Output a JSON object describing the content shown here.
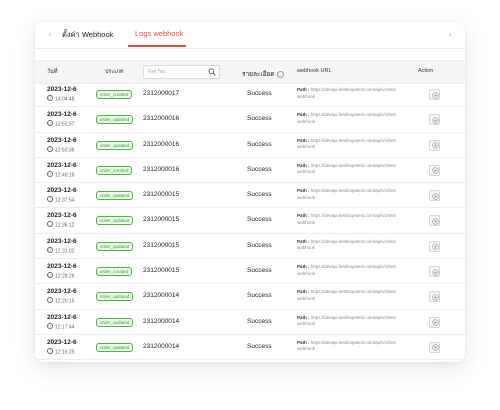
{
  "tabs": [
    {
      "label": "ตั้งค่า Webhook",
      "active": false
    },
    {
      "label": "Logs webhook",
      "active": true
    }
  ],
  "table": {
    "headers": {
      "date": "วันที่",
      "type": "ประเภท",
      "ref_placeholder": "Ref No.",
      "status": "รายละเอียด",
      "url": "webhook URL",
      "action": "Action"
    },
    "path_label": "Path :",
    "rows": [
      {
        "date": "2023-12-6",
        "time": "14:04:48",
        "type": "order_created",
        "ref": "2312000017",
        "status": "Success",
        "path": "https://devapi.ketshopstest.com/api/v1/test webhook"
      },
      {
        "date": "2023-12-6",
        "time": "12:52:57",
        "type": "order_updated",
        "ref": "2312000016",
        "status": "Success",
        "path": "https://devapi.ketshopstest.com/api/v1/test webhook"
      },
      {
        "date": "2023-12-6",
        "time": "12:50:36",
        "type": "order_updated",
        "ref": "2312000016",
        "status": "Success",
        "path": "https://devapi.ketshopstest.com/api/v1/test webhook"
      },
      {
        "date": "2023-12-6",
        "time": "12:49:16",
        "type": "order_created",
        "ref": "2312000016",
        "status": "Success",
        "path": "https://devapi.ketshopstest.com/api/v1/test webhook"
      },
      {
        "date": "2023-12-6",
        "time": "12:37:54",
        "type": "order_updated",
        "ref": "2312000015",
        "status": "Success",
        "path": "https://devapi.ketshopstest.com/api/v1/test webhook"
      },
      {
        "date": "2023-12-6",
        "time": "12:36:12",
        "type": "order_updated",
        "ref": "2312000015",
        "status": "Success",
        "path": "https://devapi.ketshopstest.com/api/v1/test webhook"
      },
      {
        "date": "2023-12-6",
        "time": "12:31:02",
        "type": "order_updated",
        "ref": "2312000015",
        "status": "Success",
        "path": "https://devapi.ketshopstest.com/api/v1/test webhook"
      },
      {
        "date": "2023-12-6",
        "time": "12:28:26",
        "type": "order_created",
        "ref": "2312000015",
        "status": "Success",
        "path": "https://devapi.ketshopstest.com/api/v1/test webhook"
      },
      {
        "date": "2023-12-6",
        "time": "12:20:15",
        "type": "order_updated",
        "ref": "2312000014",
        "status": "Success",
        "path": "https://devapi.ketshopstest.com/api/v1/test webhook"
      },
      {
        "date": "2023-12-6",
        "time": "12:17:44",
        "type": "order_updated",
        "ref": "2312000014",
        "status": "Success",
        "path": "https://devapi.ketshopstest.com/api/v1/test webhook"
      },
      {
        "date": "2023-12-6",
        "time": "12:16:25",
        "type": "order_updated",
        "ref": "2312000014",
        "status": "Success",
        "path": "https://devapi.ketshopstest.com/api/v1/test webhook"
      }
    ]
  },
  "colors": {
    "accent": "#e0503c",
    "badge_green": "#4bb543",
    "header_bg": "#f5f5f5"
  },
  "icons": {
    "tab_prev": "chevron-left-icon",
    "tab_next": "chevron-right-icon",
    "search": "search-icon",
    "info": "info-icon",
    "clock": "clock-icon",
    "action": "view-details-icon"
  }
}
